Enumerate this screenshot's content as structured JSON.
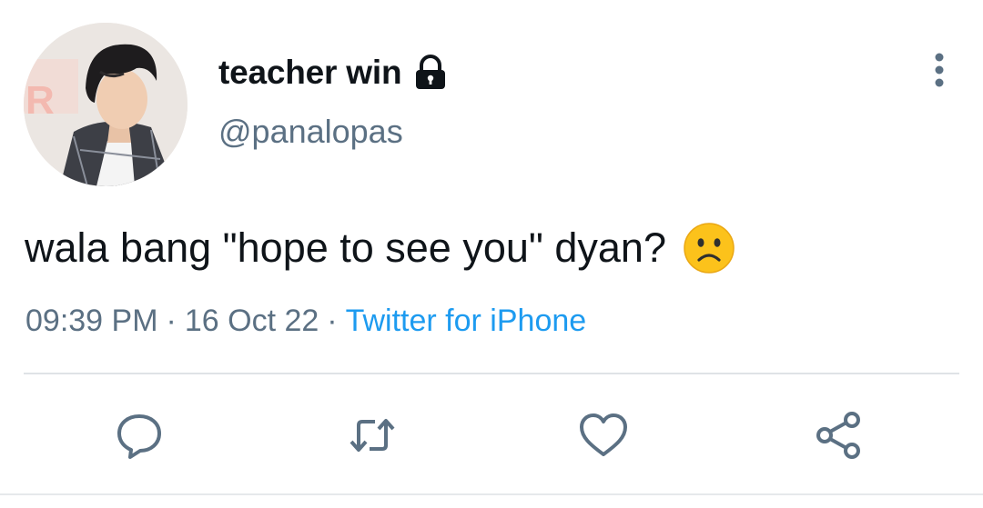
{
  "tweet": {
    "display_name": "teacher win",
    "username": "@panalopas",
    "text": "wala bang \"hope to see you\" dyan?",
    "time": "09:39 PM",
    "date": "16 Oct 22",
    "source": "Twitter for iPhone",
    "separator": "·"
  },
  "icons": {
    "lock": "lock-icon",
    "more": "more-vertical-icon",
    "emoji": "slightly-frowning-face-icon",
    "reply": "reply-icon",
    "retweet": "retweet-icon",
    "like": "heart-icon",
    "share": "share-icon"
  },
  "colors": {
    "text": "#0f1419",
    "secondary": "#5b7083",
    "link": "#1d9bf0",
    "divider": "#dfe3e6"
  }
}
